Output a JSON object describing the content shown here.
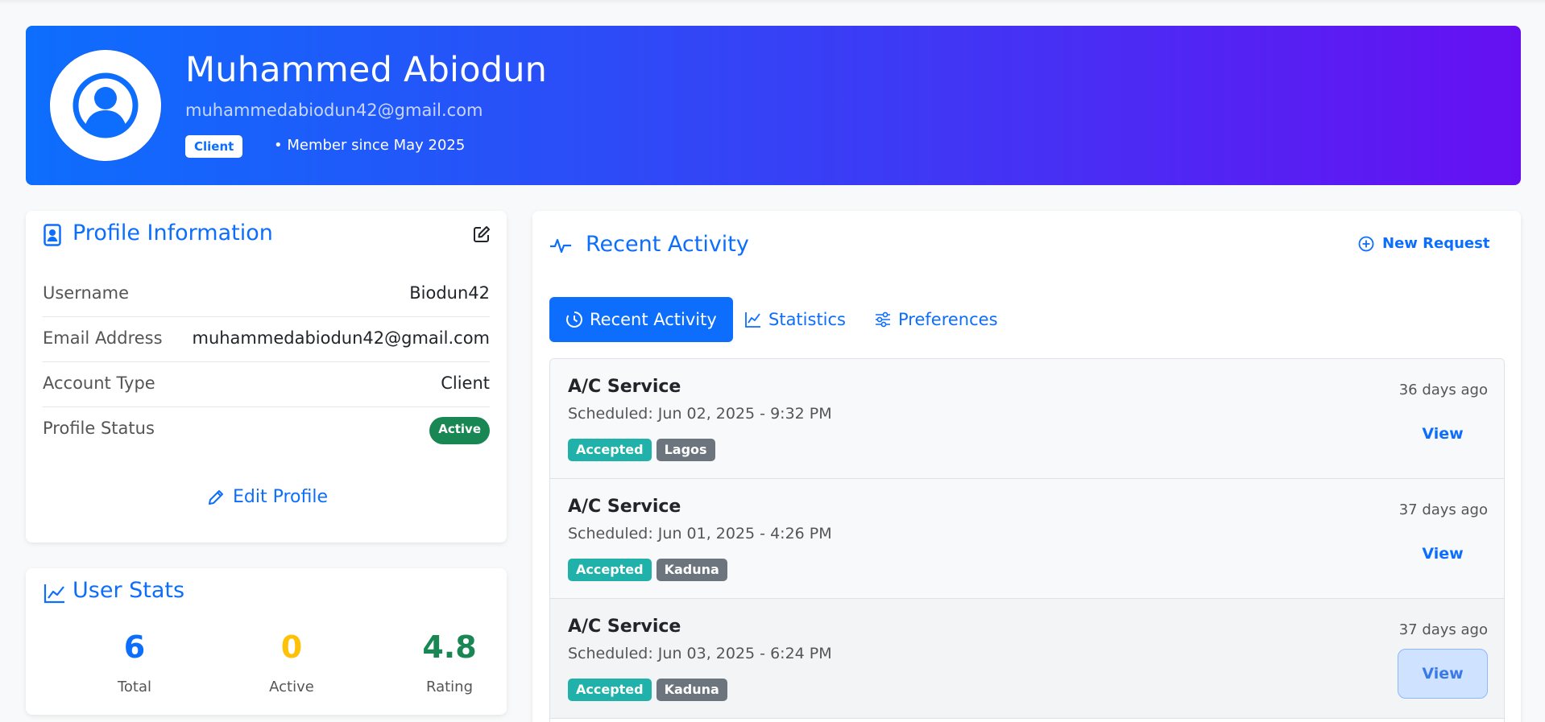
{
  "profile": {
    "name": "Muhammed Abiodun",
    "email": "muhammedabiodun42@gmail.com",
    "role_badge": "Client",
    "member_since": "• Member since May 2025"
  },
  "profile_info": {
    "title": "Profile Information",
    "rows": [
      {
        "label": "Username",
        "value": "Biodun42"
      },
      {
        "label": "Email Address",
        "value": "muhammedabiodun42@gmail.com"
      },
      {
        "label": "Account Type",
        "value": "Client"
      },
      {
        "label": "Profile Status",
        "value": "Active"
      }
    ],
    "edit_label": "Edit Profile"
  },
  "user_stats": {
    "title": "User Stats",
    "items": [
      {
        "value": "6",
        "label": "Total",
        "color": "#0d6efd"
      },
      {
        "value": "0",
        "label": "Active",
        "color": "#ffc107"
      },
      {
        "value": "4.8",
        "label": "Rating",
        "color": "#198754"
      }
    ]
  },
  "activity": {
    "title": "Recent Activity",
    "new_request_label": "New Request",
    "tabs": [
      {
        "label": "Recent Activity",
        "icon": "clock-icon"
      },
      {
        "label": "Statistics",
        "icon": "chart-line-icon"
      },
      {
        "label": "Preferences",
        "icon": "sliders-icon"
      }
    ],
    "items": [
      {
        "title": "A/C Service",
        "scheduled": "Scheduled: Jun 02, 2025 - 9:32 PM",
        "status": "Accepted",
        "location": "Lagos",
        "ago": "36 days ago",
        "action": "View"
      },
      {
        "title": "A/C Service",
        "scheduled": "Scheduled: Jun 01, 2025 - 4:26 PM",
        "status": "Accepted",
        "location": "Kaduna",
        "ago": "37 days ago",
        "action": "View"
      },
      {
        "title": "A/C Service",
        "scheduled": "Scheduled: Jun 03, 2025 - 6:24 PM",
        "status": "Accepted",
        "location": "Kaduna",
        "ago": "37 days ago",
        "action": "View"
      }
    ]
  },
  "colors": {
    "primary": "#0d6efd",
    "gradient_end": "#6610f2",
    "success": "#198754",
    "warning": "#ffc107",
    "info": "#20b2aa"
  }
}
